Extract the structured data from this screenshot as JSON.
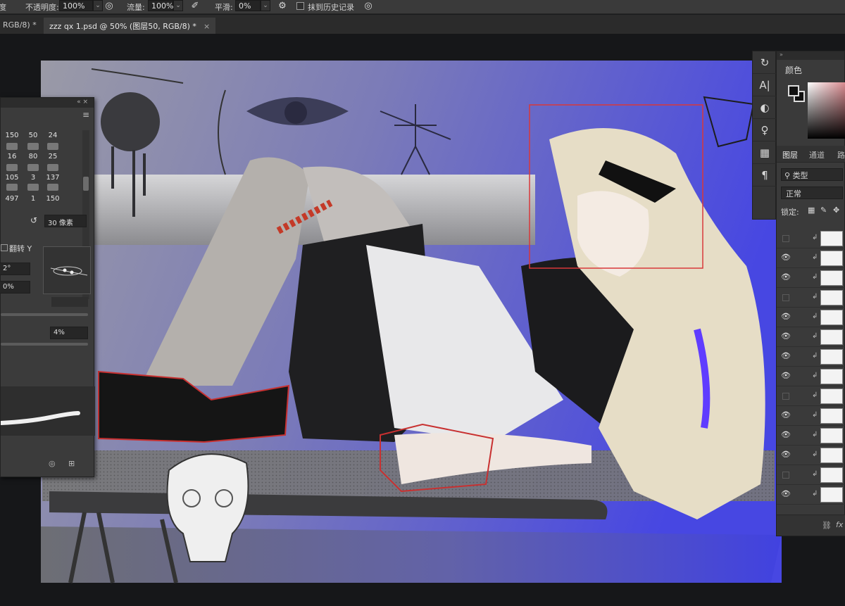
{
  "options_bar": {
    "opacity_label": "不透明度:",
    "opacity_value": "100%",
    "flow_label": "流量:",
    "flow_value": "100%",
    "smoothing_label": "平滑:",
    "smoothing_value": "0%",
    "erase_history_label": "抹到历史记录"
  },
  "tabs": [
    {
      "label": "RGB/8) *"
    },
    {
      "label": "zzz qx 1.psd @ 50% (图层50, RGB/8) *"
    }
  ],
  "brush_panel": {
    "brush_sizes": [
      "150",
      "50",
      "24",
      "16",
      "80",
      "25",
      "105",
      "3",
      "137",
      "497",
      "1",
      "150"
    ],
    "size_value": "30 像素",
    "flip_y_label": "翻转 Y",
    "angle_value": "2°",
    "roundness_value": "0%",
    "spacing_value": "4%"
  },
  "color_panel": {
    "title": "颜色"
  },
  "layers_panel": {
    "tabs": [
      "图层",
      "通道",
      "路"
    ],
    "filter_label": "类型",
    "blend_mode": "正常",
    "lock_label": "锁定:",
    "rows": [
      {
        "visible": false
      },
      {
        "visible": true
      },
      {
        "visible": true
      },
      {
        "visible": false
      },
      {
        "visible": true
      },
      {
        "visible": true
      },
      {
        "visible": true
      },
      {
        "visible": true
      },
      {
        "visible": false
      },
      {
        "visible": true
      },
      {
        "visible": true
      },
      {
        "visible": true
      },
      {
        "visible": false
      },
      {
        "visible": true
      }
    ]
  },
  "icons": {
    "brush_tool": "brush-icon",
    "airbrush": "airbrush-icon",
    "settings": "gear-icon",
    "history": "history-icon",
    "character": "character-icon",
    "adjustments": "adjustments-icon",
    "styles": "styles-icon",
    "libraries": "libraries-icon",
    "paragraph": "paragraph-icon"
  },
  "colors": {
    "canvas_blue": "#4a4de0",
    "ui_dark": "#3a3a3a",
    "selection_red": "#d8383a",
    "accent_purple": "#5f3cff"
  }
}
